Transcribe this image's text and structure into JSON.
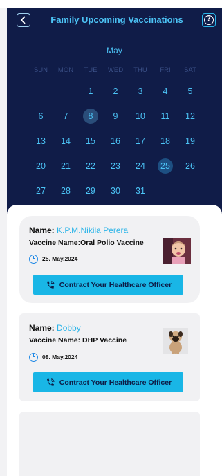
{
  "header": {
    "title": "Family Upcoming Vaccinations",
    "back_icon": "chevron-left-icon",
    "help_icon": "question-circle-icon",
    "help_glyph": "?"
  },
  "calendar": {
    "month": "May",
    "weekdays": [
      "SUN",
      "MON",
      "TUE",
      "WED",
      "THU",
      "FRI",
      "SAT"
    ],
    "weeks": [
      [
        "",
        "",
        "1",
        "2",
        "3",
        "4",
        "5"
      ],
      [
        "6",
        "7",
        "8",
        "9",
        "10",
        "11",
        "12"
      ],
      [
        "13",
        "14",
        "15",
        "16",
        "17",
        "18",
        "19"
      ],
      [
        "20",
        "21",
        "22",
        "23",
        "24",
        "25",
        "26"
      ],
      [
        "27",
        "28",
        "29",
        "30",
        "31",
        "",
        ""
      ]
    ],
    "today": "8",
    "selected": "25",
    "colors": {
      "background": "#101c48",
      "accent": "#4cc3f5",
      "weekday": "#3a4f86"
    }
  },
  "vaccinations": [
    {
      "name_label": "Name:",
      "name": "K.P.M.Nikila Perera",
      "vaccine": "Vaccine Name:Oral Polio Vaccine",
      "date": "25. May.2024",
      "button": "Contract Your Healthcare Officer",
      "photo": "baby-photo"
    },
    {
      "name_label": "Name:",
      "name": "Dobby",
      "vaccine": "Vaccine Name: DHP Vaccine",
      "date": "08. May.2024",
      "button": "Contract Your Healthcare Officer",
      "photo": "dog-photo"
    }
  ],
  "colors": {
    "button": "#19b6e6",
    "button_text": "#0d1b45",
    "name_value": "#2bb4e8",
    "clock": "#1e88e5"
  }
}
